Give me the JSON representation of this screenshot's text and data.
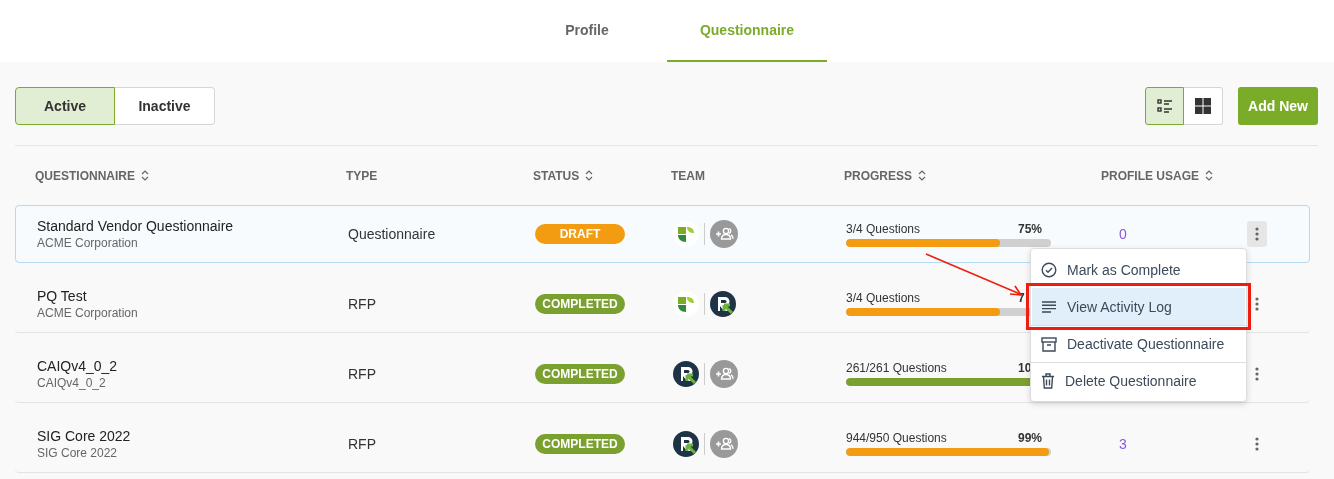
{
  "tabs": [
    {
      "label": "Profile",
      "selected": false
    },
    {
      "label": "Questionnaire",
      "selected": true
    }
  ],
  "filter": [
    {
      "label": "Active",
      "selected": true
    },
    {
      "label": "Inactive",
      "selected": false
    }
  ],
  "view_toggle": [
    {
      "kind": "list",
      "selected": true
    },
    {
      "kind": "grid",
      "selected": false
    }
  ],
  "add_button": "Add New",
  "table": {
    "columns": [
      {
        "label": "QUESTIONNAIRE",
        "sortable": true
      },
      {
        "label": "TYPE",
        "sortable": false
      },
      {
        "label": "STATUS",
        "sortable": true
      },
      {
        "label": "TEAM",
        "sortable": false
      },
      {
        "label": "PROGRESS",
        "sortable": true
      },
      {
        "label": "PROFILE USAGE",
        "sortable": true
      }
    ],
    "rows": [
      {
        "name": "Standard Vendor Questionnaire",
        "owner": "ACME Corporation",
        "type": "Questionnaire",
        "status": {
          "label": "DRAFT",
          "color": "#f39c12"
        },
        "team": [
          {
            "kind": "leaf"
          },
          {
            "kind": "add-member"
          }
        ],
        "progress_label": "3/4 Questions",
        "percent": "75%",
        "level": 0.75,
        "usage": "0",
        "selected": true,
        "menu_open": true
      },
      {
        "name": "PQ Test",
        "owner": "ACME Corporation",
        "type": "RFP",
        "status": {
          "label": "COMPLETED",
          "color": "#7aa12f"
        },
        "team": [
          {
            "kind": "leaf"
          },
          {
            "kind": "r-logo"
          }
        ],
        "progress_label": "3/4 Questions",
        "percent": "7",
        "level": 0.75,
        "selected": false,
        "menu_open": false
      },
      {
        "name": "CAIQv4_0_2",
        "owner": "CAIQv4_0_2",
        "type": "RFP",
        "status": {
          "label": "COMPLETED",
          "color": "#7aa12f"
        },
        "team": [
          {
            "kind": "r-logo"
          },
          {
            "kind": "add-member"
          }
        ],
        "progress_label": "261/261 Questions",
        "percent": "10",
        "level": 1,
        "selected": false,
        "menu_open": false
      },
      {
        "name": "SIG Core 2022",
        "owner": "SIG Core 2022",
        "type": "RFP",
        "status": {
          "label": "COMPLETED",
          "color": "#7aa12f"
        },
        "team": [
          {
            "kind": "r-logo"
          },
          {
            "kind": "add-member"
          }
        ],
        "progress_label": "944/950 Questions",
        "percent": "99%",
        "level": 0.99,
        "usage": "3",
        "selected": false,
        "menu_open": false
      }
    ]
  },
  "row_menu": {
    "items": [
      {
        "label": "Mark as Complete",
        "selected": false,
        "callout": false
      },
      {
        "label": "View Activity Log",
        "selected": true,
        "callout": true
      },
      {
        "label": "Deactivate Questionnaire",
        "selected": false,
        "callout": false
      },
      {
        "label": "Delete Questionnaire",
        "selected": false,
        "callout": false
      }
    ]
  }
}
